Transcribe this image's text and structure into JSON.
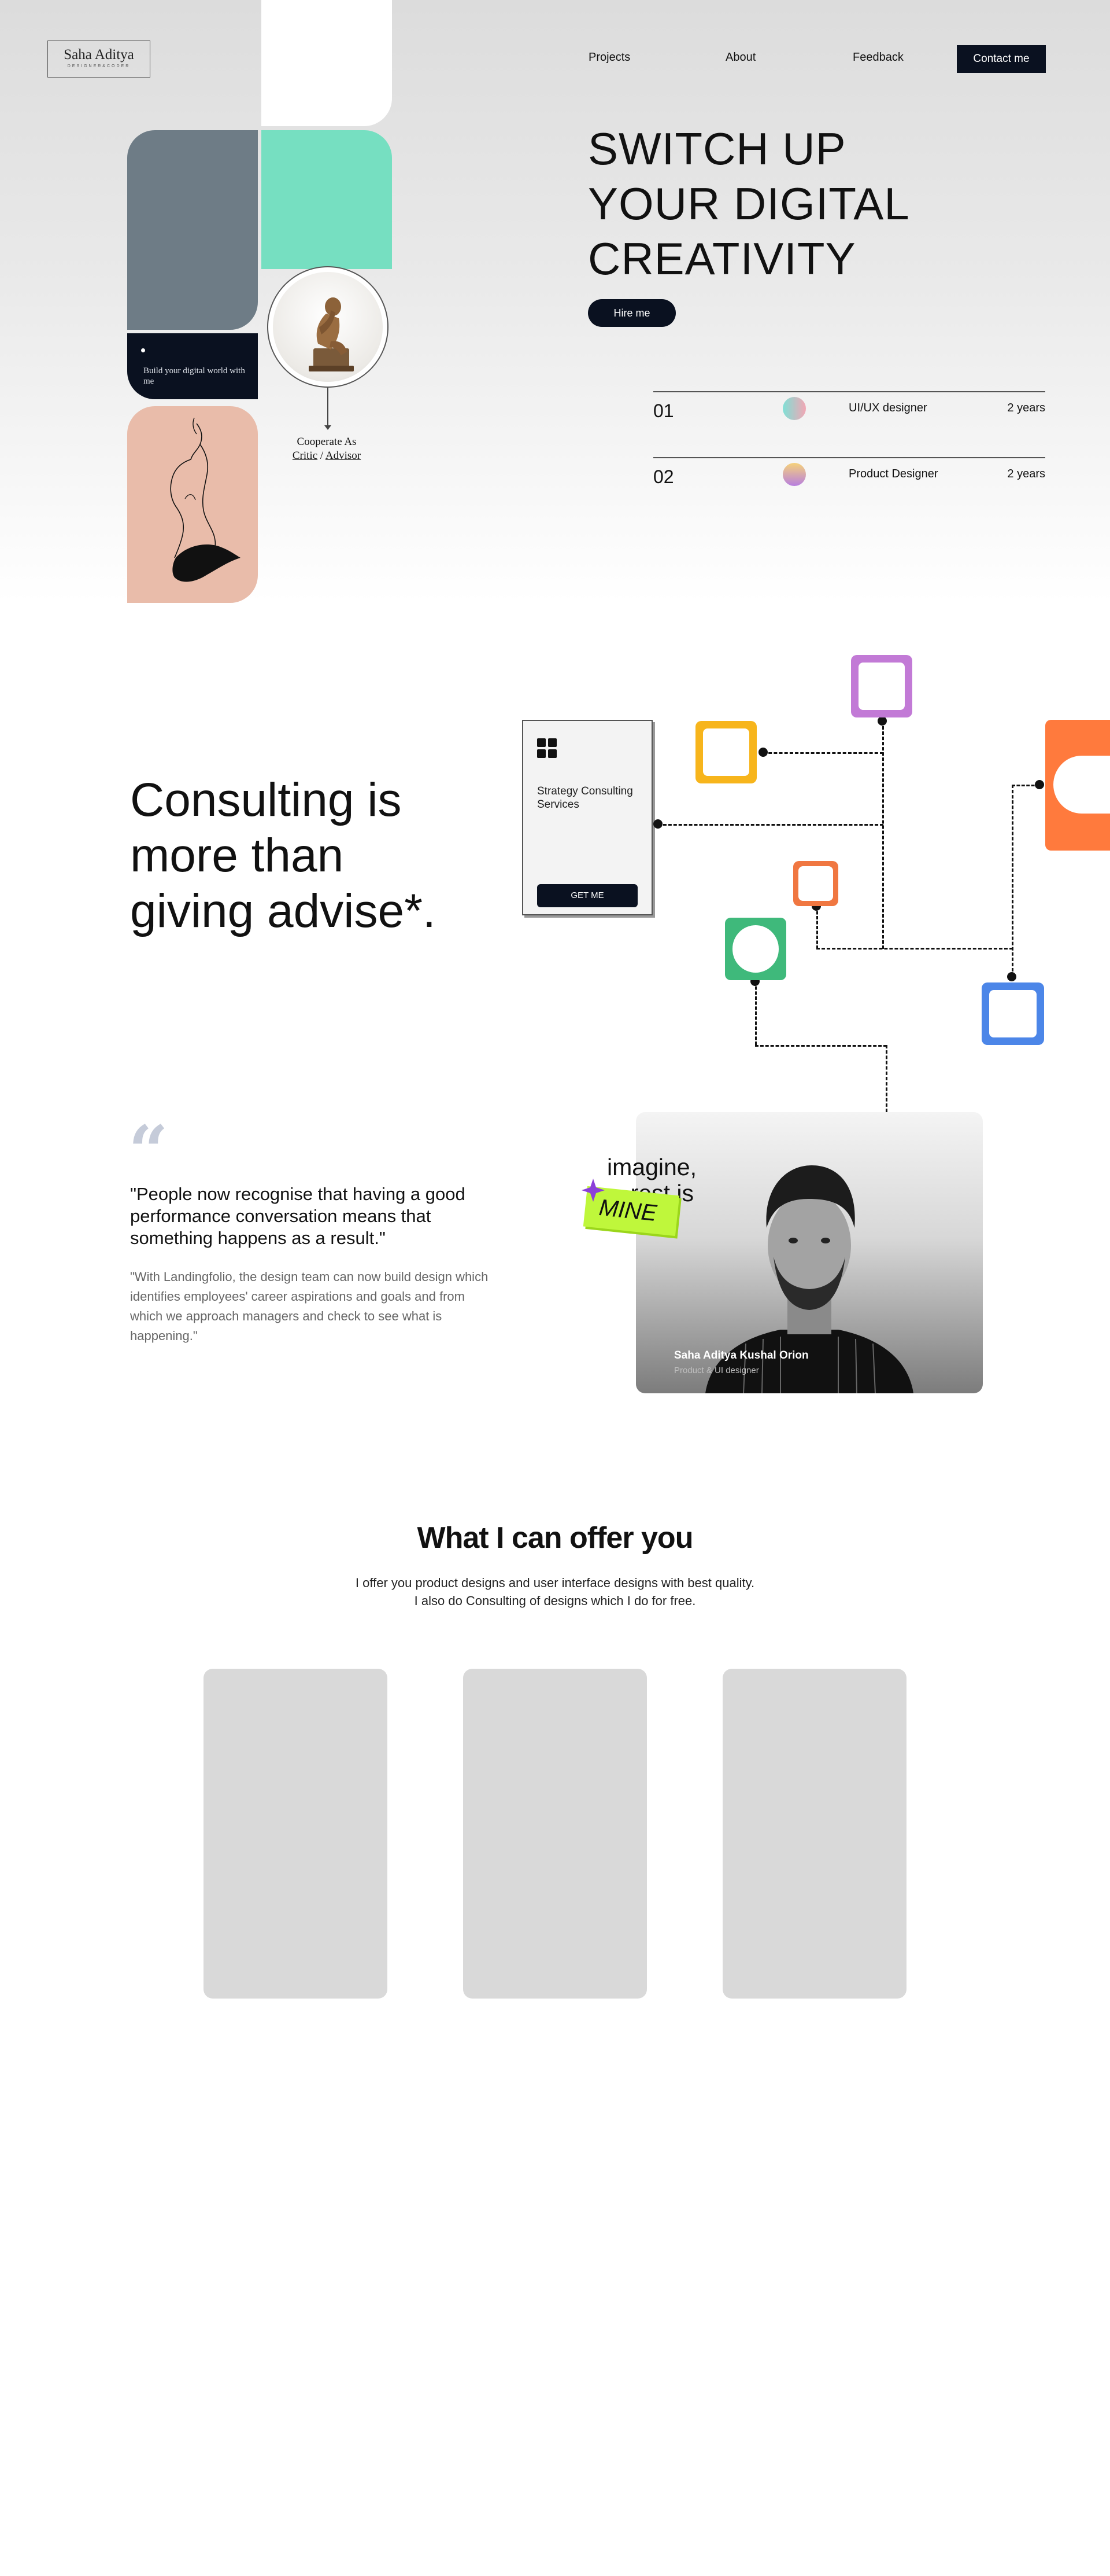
{
  "brand": {
    "name": "Saha Aditya",
    "tagline": "DESIGNER&CODER"
  },
  "nav": {
    "links": [
      "Projects",
      "About",
      "Feedback"
    ],
    "contact_label": "Contact me"
  },
  "hero": {
    "title_lines": [
      "SWITCH UP",
      "YOUR DIGITAL",
      "CREATIVITY"
    ],
    "hire_label": "Hire me",
    "collage_caption": "Build your digital world with me",
    "cooperate_label": "Cooperate As",
    "critic_label": "Critic",
    "separator": " / ",
    "advisor_label": "Advisor"
  },
  "roles": [
    {
      "num": "01",
      "title": "UI/UX designer",
      "years": "2 years",
      "swatch_from": "#7fe0d6",
      "swatch_to": "#f3a6b4"
    },
    {
      "num": "02",
      "title": "Product Designer",
      "years": "2 years",
      "swatch_from": "#f6d27a",
      "swatch_to": "#b77ee0"
    }
  ],
  "consulting": {
    "title_lines": [
      "Consulting is",
      "more than",
      "giving advise*."
    ],
    "card_title": "Strategy Consulting Services",
    "card_button": "GET ME"
  },
  "nodes": [
    {
      "name": "yellow-node",
      "color": "#f7b51c"
    },
    {
      "name": "purple-node",
      "color": "#c27ad6"
    },
    {
      "name": "orange-side-node",
      "color": "#ff7a3d"
    },
    {
      "name": "orange-small-node",
      "color": "#f07741"
    },
    {
      "name": "green-node",
      "color": "#3fb97b"
    },
    {
      "name": "blue-node",
      "color": "#4c86e8"
    }
  ],
  "testimonial": {
    "quote": "\"People now recognise that having a good performance conversation means that something happens as a result.\"",
    "body": "\"With Landingfolio, the design team can now build design which identifies employees' career aspirations and goals and from which we approach managers and check to see what is happening.\"",
    "person_name": "Saha Aditya Kushal Orion",
    "person_role": "Product & UI designer",
    "sticker_line1": "imagine,",
    "sticker_line2": "rest is",
    "sticker_tag": "MINE"
  },
  "offer": {
    "title": "What I can offer you",
    "sub_line1": "I offer you product designs and user interface designs with best quality.",
    "sub_line2": "I also do Consulting of designs which I do for free."
  },
  "colors": {
    "navy": "#0a1120",
    "mint": "#76dfc1",
    "slate": "#6e7c86",
    "peach": "#e9bcaa",
    "lime": "#bff73b"
  }
}
